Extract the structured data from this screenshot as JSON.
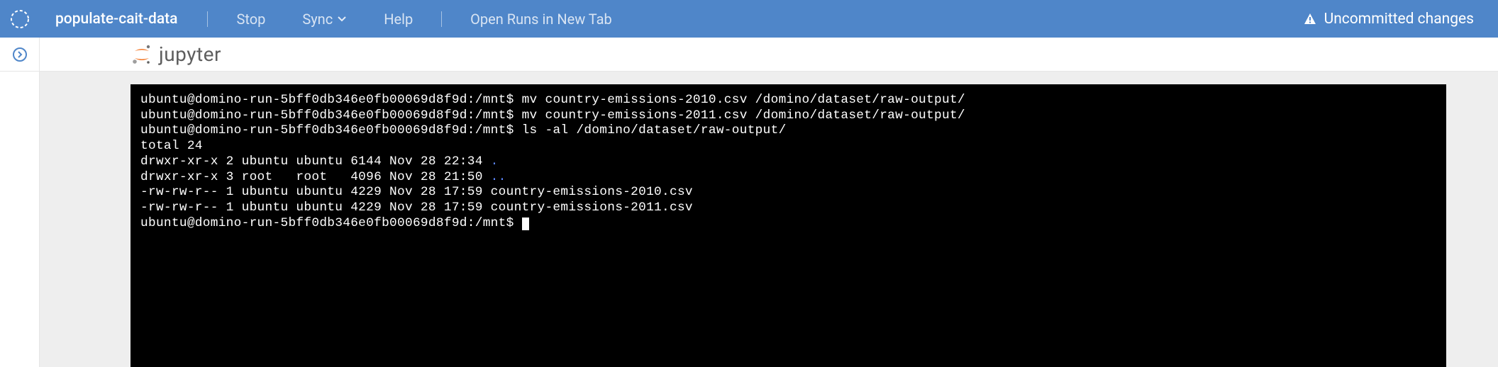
{
  "header": {
    "project_name": "populate-cait-data",
    "menu": {
      "stop": "Stop",
      "sync": "Sync",
      "help": "Help",
      "open_runs": "Open Runs in New Tab"
    },
    "status": "Uncommitted changes"
  },
  "jupyter": {
    "label": "jupyter"
  },
  "terminal": {
    "lines": [
      {
        "prompt": "ubuntu@domino-run-5bff0db346e0fb00069d8f9d:/mnt$",
        "cmd": " mv country-emissions-2010.csv /domino/dataset/raw-output/"
      },
      {
        "prompt": "ubuntu@domino-run-5bff0db346e0fb00069d8f9d:/mnt$",
        "cmd": " mv country-emissions-2011.csv /domino/dataset/raw-output/"
      },
      {
        "prompt": "ubuntu@domino-run-5bff0db346e0fb00069d8f9d:/mnt$",
        "cmd": " ls -al /domino/dataset/raw-output/"
      }
    ],
    "output": {
      "total": "total 24",
      "rows": [
        {
          "perm": "drwxr-xr-x 2 ubuntu ubuntu 6144 Nov 28 22:34 ",
          "name": ".",
          "cls": "dot-cur"
        },
        {
          "perm": "drwxr-xr-x 3 root   root   4096 Nov 28 21:50 ",
          "name": "..",
          "cls": "dot-parent"
        },
        {
          "perm": "-rw-rw-r-- 1 ubuntu ubuntu 4229 Nov 28 17:59 ",
          "name": "country-emissions-2010.csv",
          "cls": ""
        },
        {
          "perm": "-rw-rw-r-- 1 ubuntu ubuntu 4229 Nov 28 17:59 ",
          "name": "country-emissions-2011.csv",
          "cls": ""
        }
      ]
    },
    "final_prompt": "ubuntu@domino-run-5bff0db346e0fb00069d8f9d:/mnt$ "
  }
}
